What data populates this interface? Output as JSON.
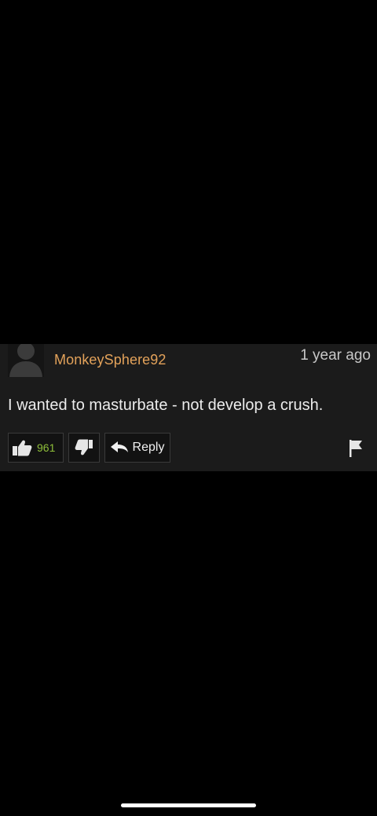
{
  "comment": {
    "username": "MonkeySphere92",
    "timestamp": "1 year ago",
    "text": "I wanted to masturbate - not develop a crush.",
    "likes": "961",
    "reply_label": "Reply"
  },
  "icons": {
    "avatar": "user-avatar-placeholder-icon",
    "like": "thumbs-up-icon",
    "dislike": "thumbs-down-icon",
    "reply": "reply-arrow-icon",
    "flag": "flag-icon"
  },
  "colors": {
    "username": "#e3a25a",
    "likes": "#8fbf3a",
    "background": "#000000",
    "comment_bg": "#1b1b1b"
  }
}
